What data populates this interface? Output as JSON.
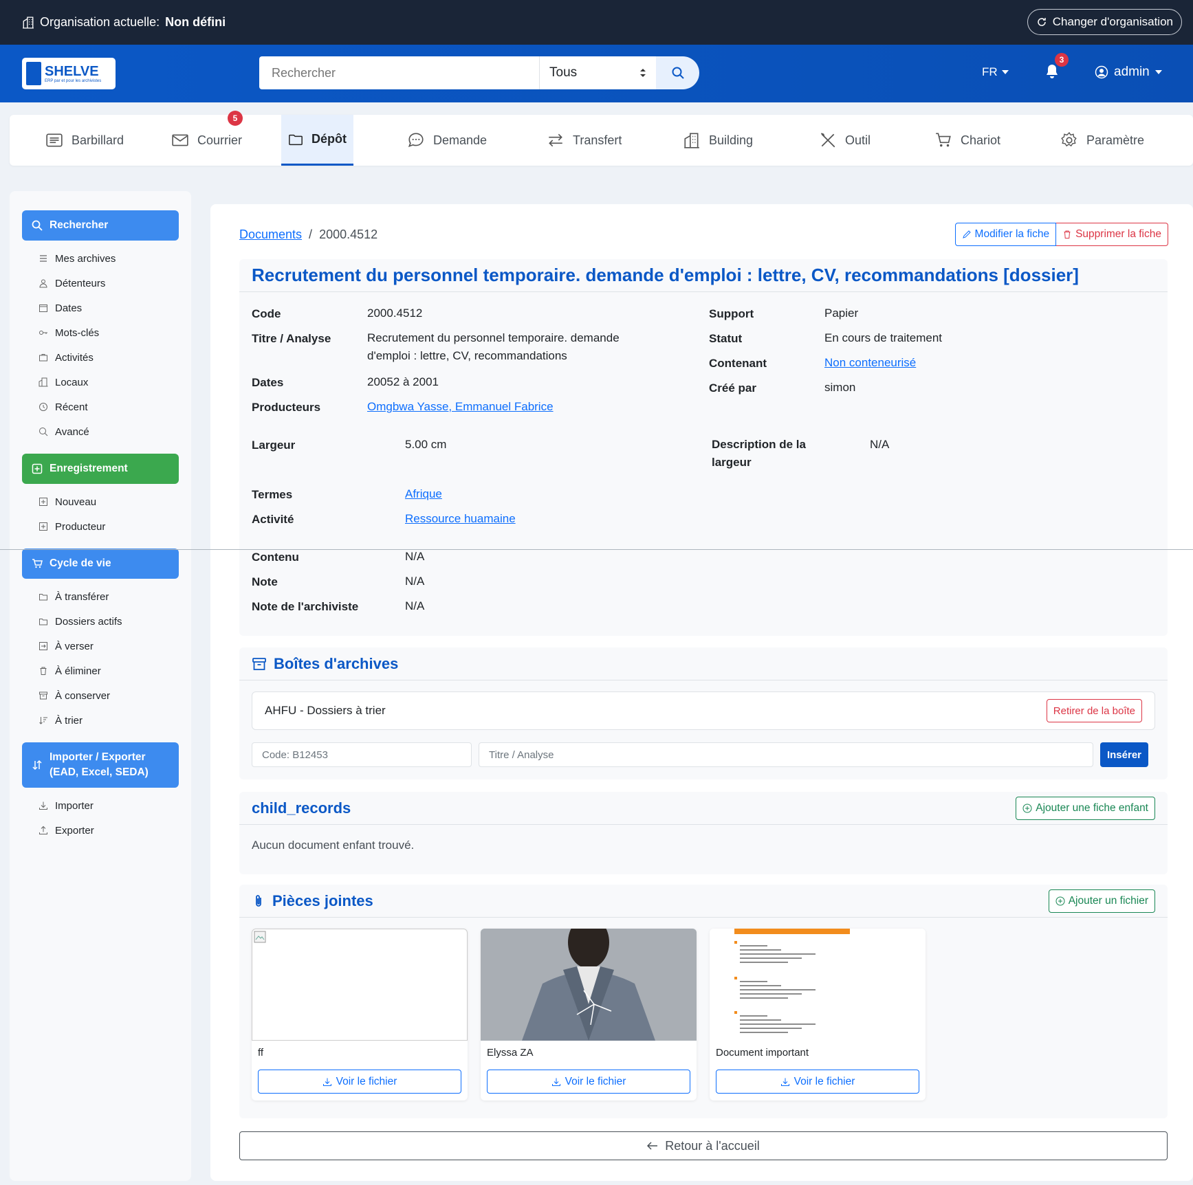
{
  "orgbar": {
    "label": "Organisation actuelle:",
    "value": "Non défini",
    "change_button": "Changer d'organisation"
  },
  "header": {
    "logo_text": "SHELVE",
    "logo_sub": "ERP par et pour les archivistes",
    "search_placeholder": "Rechercher",
    "search_scope": "Tous",
    "lang": "FR",
    "notif_count": "3",
    "user": "admin"
  },
  "tabs": [
    {
      "label": "Barbillard",
      "icon": "board-icon"
    },
    {
      "label": "Courrier",
      "icon": "mail-icon",
      "badge": "5"
    },
    {
      "label": "Dépôt",
      "icon": "folder-icon",
      "active": true
    },
    {
      "label": "Demande",
      "icon": "chat-icon"
    },
    {
      "label": "Transfert",
      "icon": "transfer-icon"
    },
    {
      "label": "Building",
      "icon": "building-icon"
    },
    {
      "label": "Outil",
      "icon": "tools-icon"
    },
    {
      "label": "Chariot",
      "icon": "cart-icon"
    },
    {
      "label": "Paramètre",
      "icon": "gear-icon"
    }
  ],
  "sidebar": {
    "search_head": "Rechercher",
    "search_items": [
      "Mes archives",
      "Détenteurs",
      "Dates",
      "Mots-clés",
      "Activités",
      "Locaux",
      "Récent",
      "Avancé"
    ],
    "record_head": "Enregistrement",
    "record_items": [
      "Nouveau",
      "Producteur"
    ],
    "lifecycle_head": "Cycle de vie",
    "lifecycle_items": [
      "À transférer",
      "Dossiers actifs",
      "À verser",
      "À éliminer",
      "À conserver",
      "À trier"
    ],
    "import_head_1": "Importer / Exporter",
    "import_head_2": "(EAD, Excel, SEDA)",
    "import_items": [
      "Importer",
      "Exporter"
    ]
  },
  "breadcrumb": {
    "root": "Documents",
    "sep": "/",
    "current": "2000.4512"
  },
  "actions": {
    "edit": "Modifier la fiche",
    "delete": "Supprimer la fiche"
  },
  "record": {
    "title": "Recrutement du personnel temporaire. demande d'emploi : lettre, CV, recommandations [dossier]",
    "code_label": "Code",
    "code": "2000.4512",
    "titre_label": "Titre / Analyse",
    "titre_1": "Recrutement du personnel temporaire. demande",
    "titre_2": "d'emploi : lettre, CV, recommandations",
    "dates_label": "Dates",
    "dates": "20052 à 2001",
    "producteurs_label": "Producteurs",
    "producteurs": "Omgbwa Yasse, Emmanuel Fabrice",
    "support_label": "Support",
    "support": "Papier",
    "statut_label": "Statut",
    "statut": "En cours de traitement",
    "contenant_label": "Contenant",
    "contenant": "Non conteneurisé",
    "cree_label": "Créé par",
    "cree": "simon",
    "largeur_label": "Largeur",
    "largeur": "5.00 cm",
    "desc_largeur_label_1": "Description de la",
    "desc_largeur_label_2": "largeur",
    "desc_largeur": "N/A",
    "termes_label": "Termes",
    "termes": "Afrique",
    "activite_label": "Activité",
    "activite": "Ressource huamaine",
    "contenu_label": "Contenu",
    "contenu": "N/A",
    "note_label": "Note",
    "note": "N/A",
    "note_arch_label": "Note de l'archiviste",
    "note_arch": "N/A"
  },
  "boxes": {
    "title": "Boîtes d'archives",
    "box_name": "AHFU - Dossiers à trier",
    "remove": "Retirer de la boîte",
    "code_placeholder": "Code: B12453",
    "titre_placeholder": "Titre / Analyse",
    "insert": "Insérer"
  },
  "children": {
    "title": "child_records",
    "add": "Ajouter une fiche enfant",
    "empty": "Aucun document enfant trouvé."
  },
  "attachments": {
    "title": "Pièces jointes",
    "add": "Ajouter un fichier",
    "view_label": "Voir le fichier",
    "items": [
      {
        "name": "ff"
      },
      {
        "name": "Elyssa ZA"
      },
      {
        "name": "Document important"
      }
    ]
  },
  "back": "Retour à l'accueil"
}
